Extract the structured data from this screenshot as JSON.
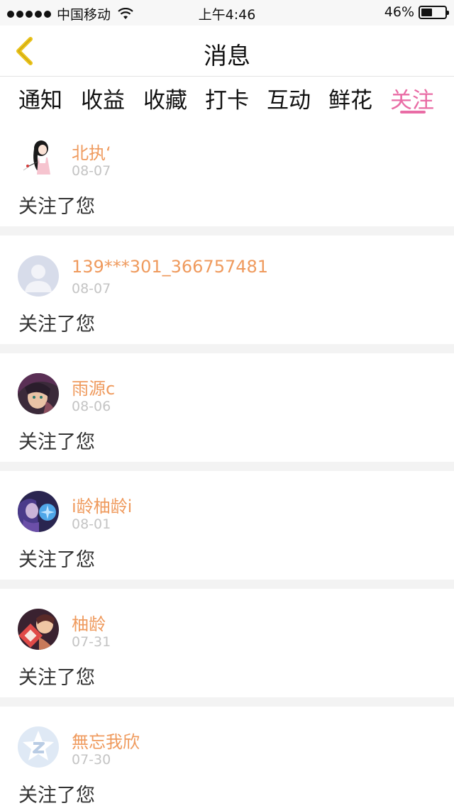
{
  "status_bar": {
    "carrier": "中国移动",
    "time": "上午4:46",
    "battery": "46%",
    "battery_level": 0.46
  },
  "nav": {
    "title": "消息",
    "back_icon": "chevron-left-icon",
    "accent_color": "#e9c21a"
  },
  "tabs": [
    {
      "label": "通知",
      "active": false
    },
    {
      "label": "收益",
      "active": false
    },
    {
      "label": "收藏",
      "active": false
    },
    {
      "label": "打卡",
      "active": false
    },
    {
      "label": "互动",
      "active": false
    },
    {
      "label": "鲜花",
      "active": false
    },
    {
      "label": "关注",
      "active": true
    }
  ],
  "colors": {
    "active_tab": "#e96ca5",
    "username": "#ef9a5d",
    "date": "#c4c4c4",
    "separator": "#f3f3f3"
  },
  "notifications": [
    {
      "user": "北执‘",
      "date": "08-07",
      "message": "关注了您",
      "avatar": "anime-girl-avatar"
    },
    {
      "user": "139***301_366757481",
      "date": "08-07",
      "message": "关注了您",
      "avatar": "default-person-avatar"
    },
    {
      "user": "雨源c",
      "date": "08-06",
      "message": "关注了您",
      "avatar": "anime-portrait-avatar"
    },
    {
      "user": "i龄柚龄i",
      "date": "08-01",
      "message": "关注了您",
      "avatar": "anime-purple-avatar"
    },
    {
      "user": "柚龄",
      "date": "07-31",
      "message": "关注了您",
      "avatar": "anime-pair-avatar"
    },
    {
      "user": "無忘我欣",
      "date": "07-30",
      "message": "关注了您",
      "avatar": "qq-star-avatar"
    }
  ]
}
